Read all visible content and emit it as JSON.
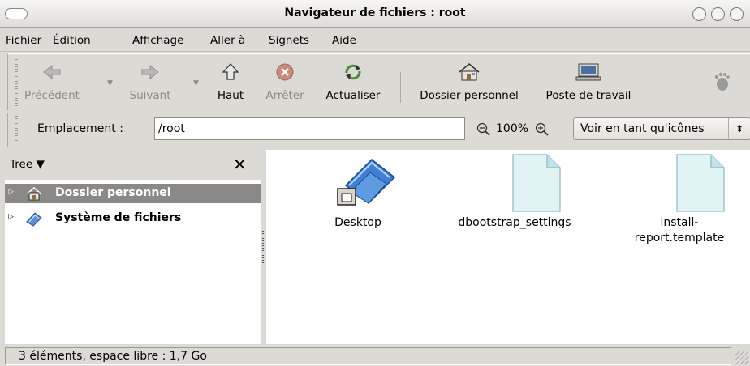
{
  "window": {
    "title": "Navigateur de fichiers : root"
  },
  "menu": {
    "items": [
      {
        "first": "F",
        "rest": "ichier",
        "pre": ""
      },
      {
        "first": "É",
        "rest": "dition",
        "pre": ""
      },
      {
        "pre": "Afficha",
        "first": "g",
        "rest": "e"
      },
      {
        "pre": "A",
        "first": "l",
        "rest": "ler à"
      },
      {
        "pre": "",
        "first": "S",
        "rest": "ignets"
      },
      {
        "pre": "",
        "first": "A",
        "rest": "ide"
      }
    ]
  },
  "toolbar": {
    "back": "Précédent",
    "forward": "Suivant",
    "up": "Haut",
    "stop": "Arrêter",
    "reload": "Actualiser",
    "home": "Dossier personnel",
    "computer": "Poste de travail"
  },
  "location": {
    "label": "Emplacement :",
    "value": "/root",
    "zoom": "100%",
    "view_mode": "Voir en tant qu'icônes"
  },
  "sidebar": {
    "title": "Tree",
    "items": [
      {
        "label": "Dossier personnel",
        "icon": "home-folder-icon",
        "selected": true
      },
      {
        "label": "Système de fichiers",
        "icon": "filesystem-icon",
        "selected": false
      }
    ]
  },
  "files": [
    {
      "name": "Desktop",
      "icon": "desktop-folder-icon"
    },
    {
      "name": "dbootstrap_settings",
      "icon": "text-file-icon"
    },
    {
      "name": "install-report.template",
      "icon": "text-file-icon"
    }
  ],
  "status": {
    "text": "3 éléments, espace libre : 1,7 Go"
  },
  "colors": {
    "selection": "#8a8987",
    "chrome": "#dcdad5"
  }
}
